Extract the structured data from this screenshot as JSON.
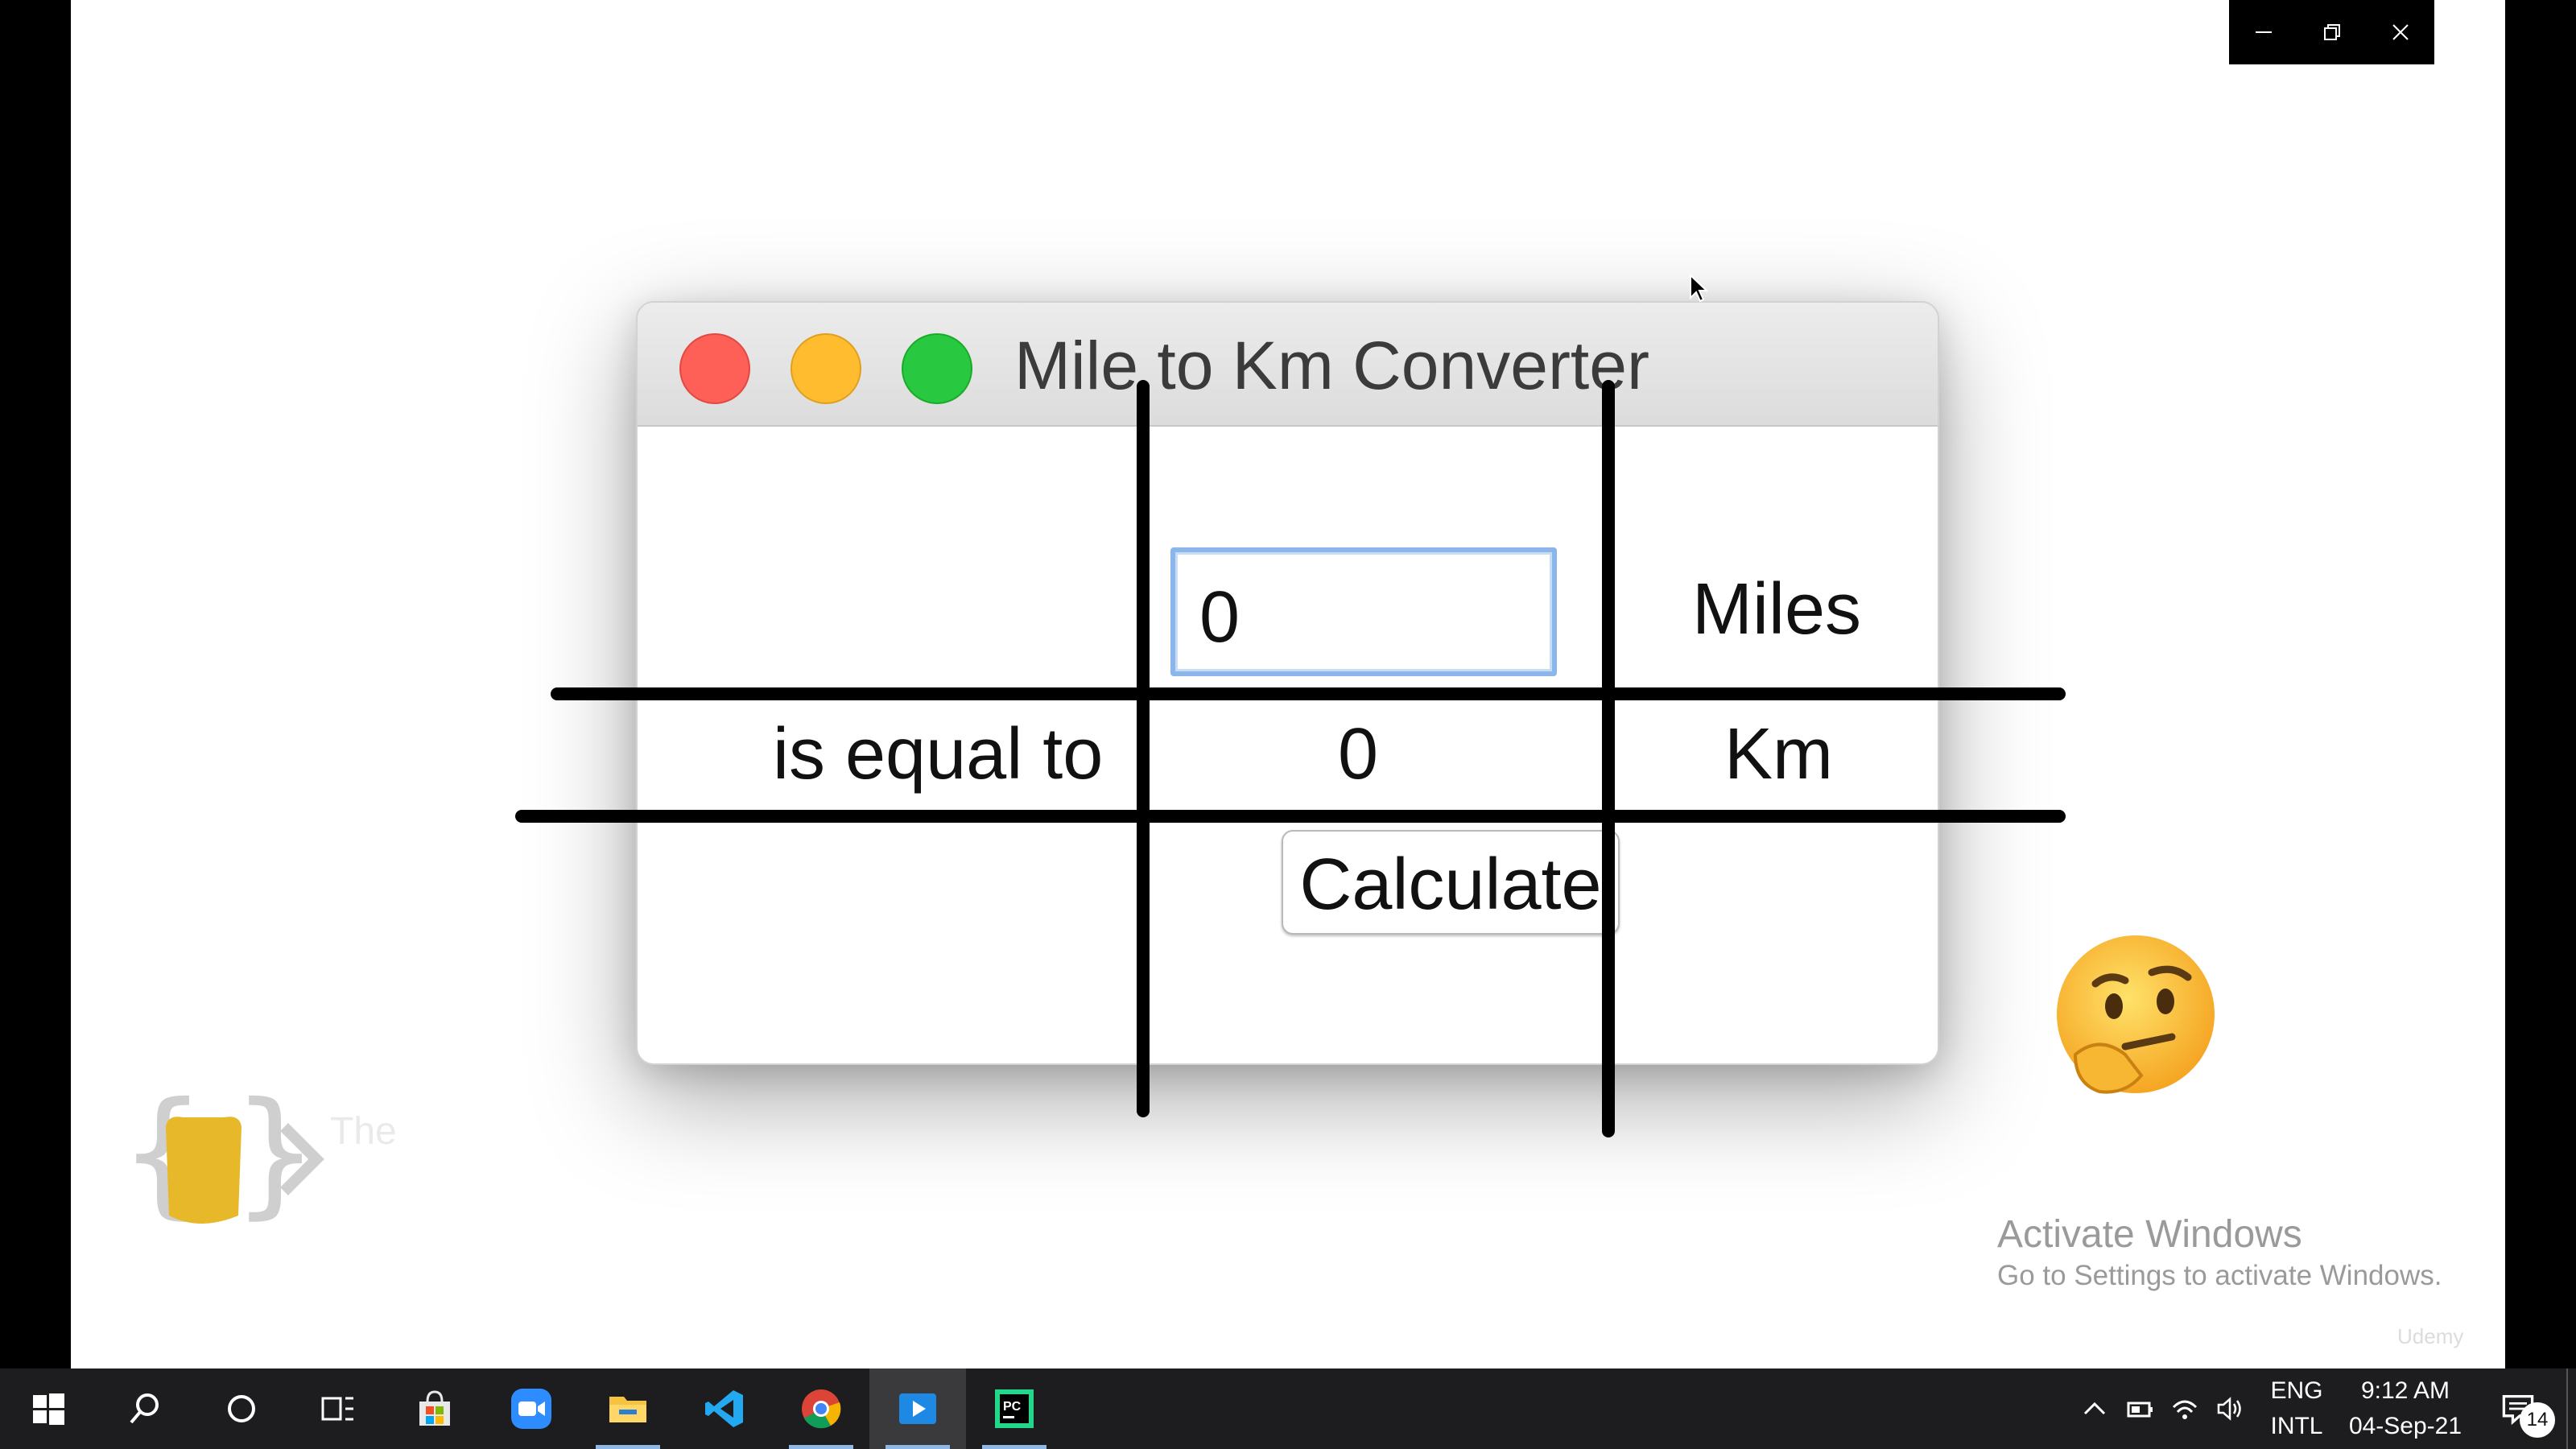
{
  "window": {
    "title": "Mile to Km Converter"
  },
  "form": {
    "input_value": "0",
    "unit_miles": "Miles",
    "equal_label": "is equal to",
    "result_value": "0",
    "unit_km": "Km",
    "calculate_label": "Calculate"
  },
  "overlay": {
    "logo_text": "The",
    "activate_title": "Activate Windows",
    "activate_sub": "Go to Settings to activate Windows.",
    "watermark": "Udemy"
  },
  "taskbar": {
    "apps": [
      {
        "name": "start",
        "icon": "windows-logo-icon"
      },
      {
        "name": "search",
        "icon": "search-icon"
      },
      {
        "name": "cortana",
        "icon": "circle-icon"
      },
      {
        "name": "task-view",
        "icon": "task-view-icon"
      },
      {
        "name": "store",
        "icon": "store-icon"
      },
      {
        "name": "zoom",
        "icon": "video-camera-icon"
      },
      {
        "name": "file-explorer",
        "icon": "folder-icon"
      },
      {
        "name": "vscode",
        "icon": "vscode-icon"
      },
      {
        "name": "chrome",
        "icon": "chrome-icon"
      },
      {
        "name": "media-player",
        "icon": "play-icon"
      },
      {
        "name": "pycharm",
        "icon": "pycharm-icon"
      }
    ],
    "lang_top": "ENG",
    "lang_bottom": "INTL",
    "time": "9:12 AM",
    "date": "04-Sep-21",
    "notification_count": "14"
  },
  "colors": {
    "close": "#fe5f57",
    "minimize": "#febc2e",
    "maximize": "#28c840",
    "input_focus": "#8bb6ea",
    "taskbar": "#1d1d1f"
  }
}
